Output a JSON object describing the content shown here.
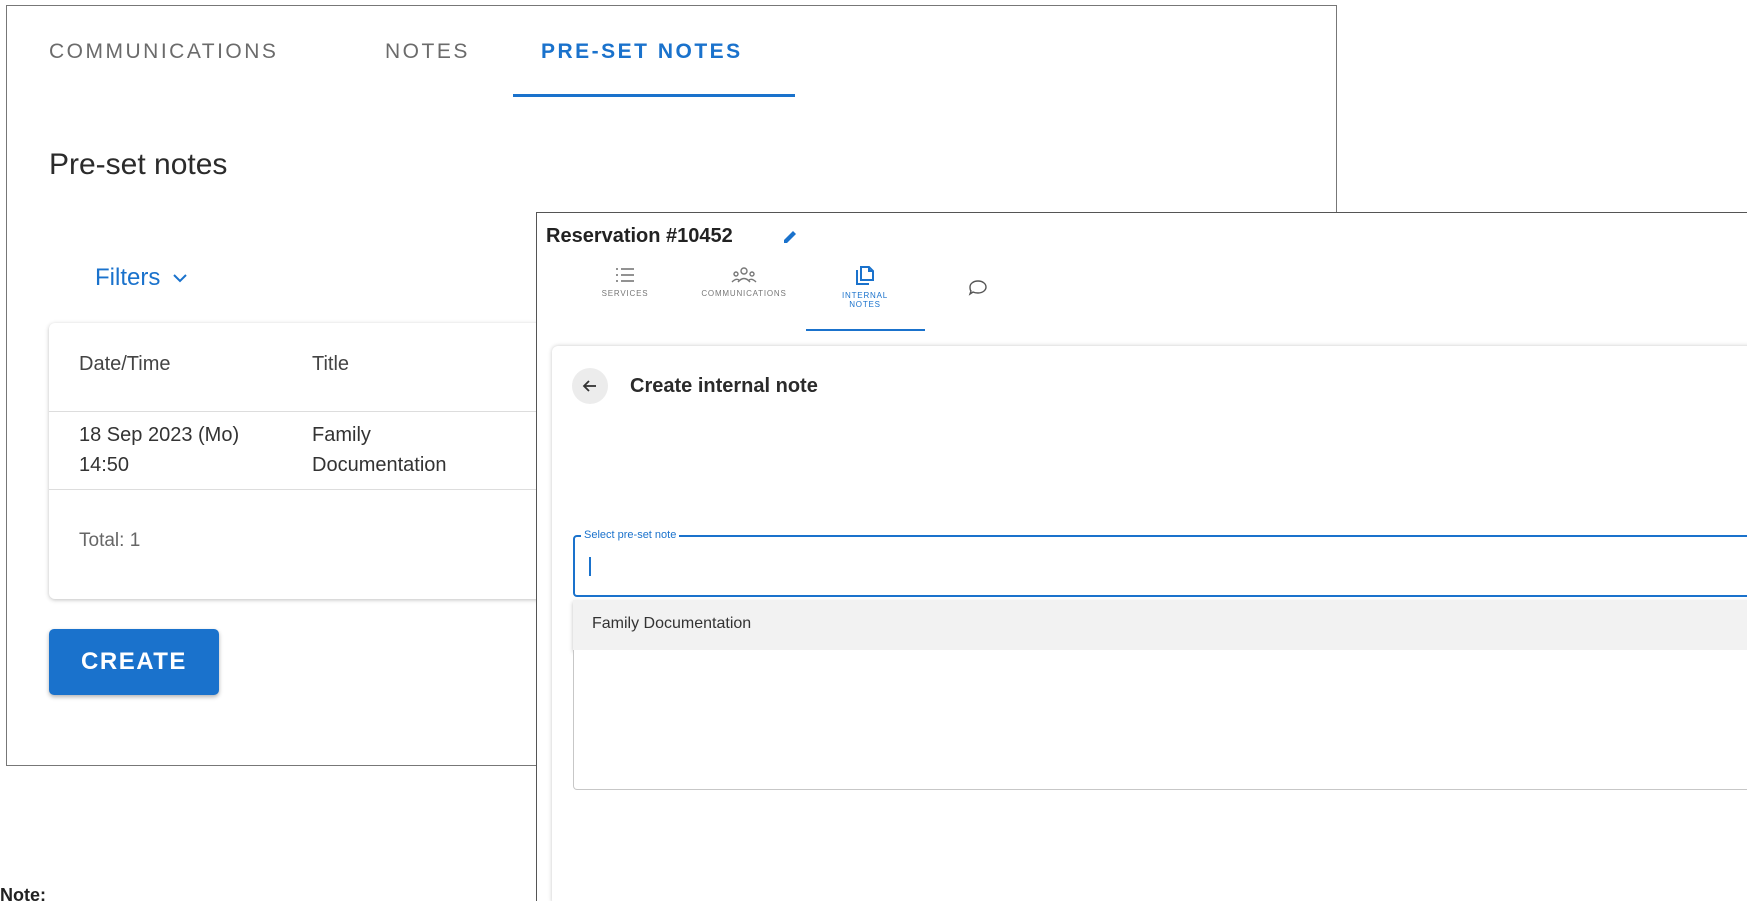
{
  "back_panel": {
    "tabs": [
      "COMMUNICATIONS",
      "NOTES",
      "PRE-SET NOTES"
    ],
    "active_tab": "PRE-SET NOTES",
    "page_title": "Pre-set notes",
    "filters_label": "Filters",
    "table": {
      "columns": [
        "Date/Time",
        "Title"
      ],
      "rows": [
        {
          "date_line1": "18 Sep 2023 (Mo)",
          "date_line2": "14:50",
          "title_line1": "Family",
          "title_line2": "Documentation"
        }
      ],
      "total": "Total: 1"
    },
    "create_label": "CREATE"
  },
  "note_caption": "Note:",
  "front_panel": {
    "reservation_title": "Reservation #10452",
    "tabs": [
      {
        "icon": "list-icon",
        "label": "SERVICES"
      },
      {
        "icon": "people-icon",
        "label": "COMMUNICATIONS"
      },
      {
        "icon": "copy-icon",
        "label_line1": "INTERNAL",
        "label_line2": "NOTES"
      },
      {
        "icon": "chat-bubble-icon",
        "label": ""
      }
    ],
    "active_tab": "INTERNAL NOTES",
    "form_title": "Create internal note",
    "select": {
      "legend": "Select pre-set note",
      "value": "",
      "options": [
        "Family Documentation"
      ]
    }
  },
  "colors": {
    "accent": "#1a72cc",
    "text": "#333333",
    "muted": "#6b6b6b"
  }
}
